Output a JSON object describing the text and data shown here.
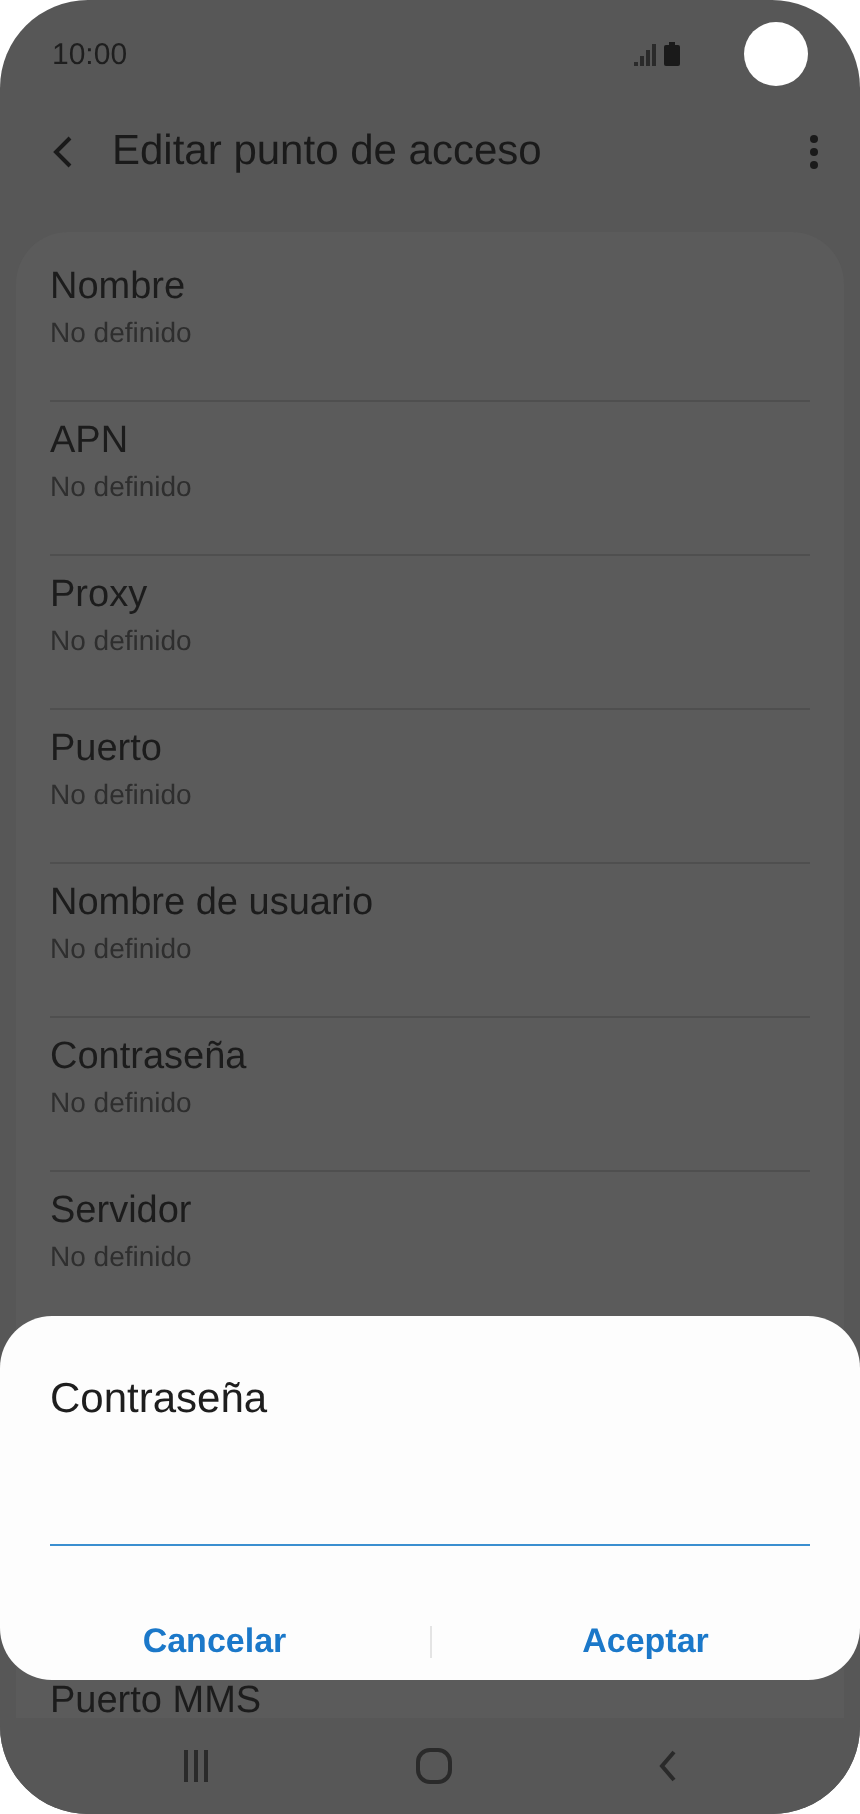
{
  "status_bar": {
    "time": "10:00"
  },
  "app_bar": {
    "title": "Editar punto de acceso"
  },
  "settings": [
    {
      "title": "Nombre",
      "value": "No definido"
    },
    {
      "title": "APN",
      "value": "No definido"
    },
    {
      "title": "Proxy",
      "value": "No definido"
    },
    {
      "title": "Puerto",
      "value": "No definido"
    },
    {
      "title": "Nombre de usuario",
      "value": "No definido"
    },
    {
      "title": "Contraseña",
      "value": "No definido"
    },
    {
      "title": "Servidor",
      "value": "No definido"
    },
    {
      "title": "Puerto MMS"
    }
  ],
  "dialog": {
    "title": "Contraseña",
    "buttons": [
      "Cancelar",
      "Aceptar"
    ]
  }
}
